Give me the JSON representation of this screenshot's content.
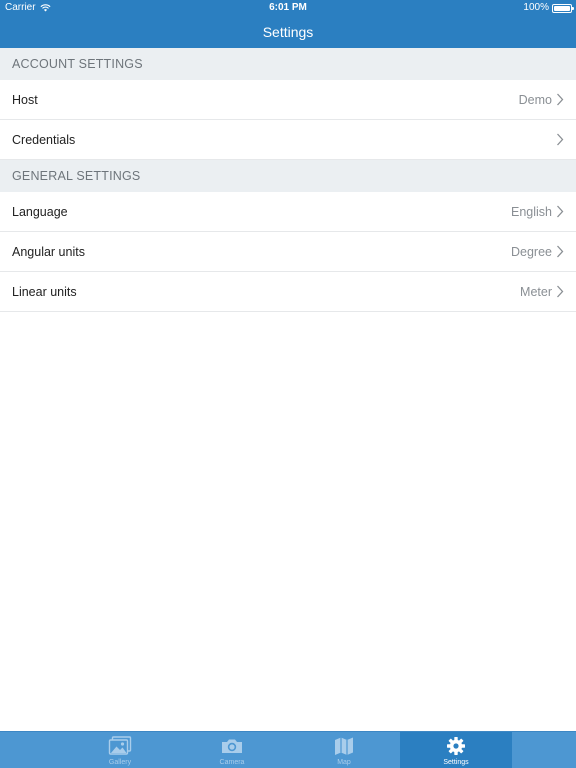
{
  "status_bar": {
    "carrier": "Carrier",
    "time": "6:01 PM",
    "battery": "100%"
  },
  "nav": {
    "title": "Settings"
  },
  "sections": [
    {
      "header": "ACCOUNT SETTINGS",
      "rows": [
        {
          "label": "Host",
          "value": "Demo"
        },
        {
          "label": "Credentials",
          "value": ""
        }
      ]
    },
    {
      "header": "GENERAL SETTINGS",
      "rows": [
        {
          "label": "Language",
          "value": "English"
        },
        {
          "label": "Angular units",
          "value": "Degree"
        },
        {
          "label": "Linear units",
          "value": "Meter"
        }
      ]
    }
  ],
  "tab_bar": {
    "tabs": [
      {
        "label": "Gallery",
        "icon": "gallery-icon"
      },
      {
        "label": "Camera",
        "icon": "camera-icon"
      },
      {
        "label": "Map",
        "icon": "map-icon"
      },
      {
        "label": "Settings",
        "icon": "gear-icon"
      }
    ],
    "selected": "Settings"
  },
  "colors": {
    "nav_blue": "#2b7fc1",
    "tab_bar_blue": "#4d97d2",
    "section_bg": "#ebeff2"
  }
}
